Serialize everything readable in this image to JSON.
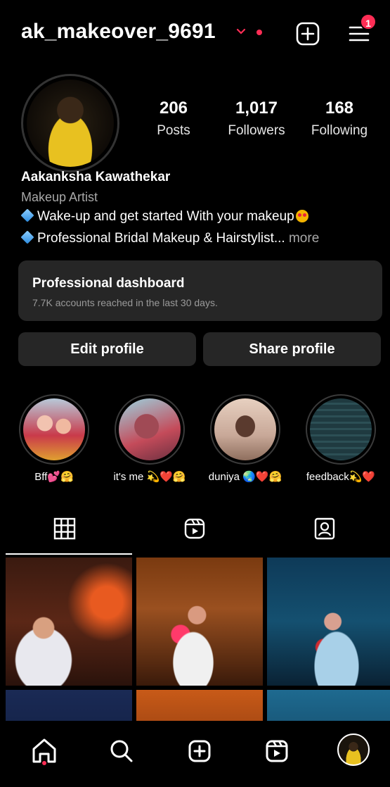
{
  "header": {
    "username": "ak_makeover_9691",
    "notification_count": "1"
  },
  "profile": {
    "stats": {
      "posts_count": "206",
      "posts_label": "Posts",
      "followers_count": "1,017",
      "followers_label": "Followers",
      "following_count": "168",
      "following_label": "Following"
    },
    "name": "Aakanksha Kawathekar",
    "category": "Makeup Artist",
    "bio_line1": "Wake-up and get started With your makeup",
    "bio_line2": "Professional Bridal Makeup & Hairstylist...",
    "more_label": "more"
  },
  "dashboard": {
    "title": "Professional dashboard",
    "subtitle": "7.7K accounts reached in the last 30 days."
  },
  "buttons": {
    "edit_profile": "Edit profile",
    "share_profile": "Share profile"
  },
  "highlights": [
    {
      "label": "Bff💕🤗"
    },
    {
      "label": "it's me 💫❤️🤗"
    },
    {
      "label": "duniya 🌏❤️🤗"
    },
    {
      "label": "feedback💫❤️"
    }
  ],
  "tabs": [
    {
      "icon": "grid-icon",
      "active": true
    },
    {
      "icon": "reels-icon",
      "active": false
    },
    {
      "icon": "tagged-icon",
      "active": false
    }
  ],
  "bottom_nav": [
    "home-icon",
    "search-icon",
    "create-icon",
    "reels-icon",
    "profile-avatar"
  ],
  "colors": {
    "background": "#000000",
    "surface": "#262626",
    "accent_red": "#ff2d55",
    "muted_text": "#a8a8a8"
  }
}
